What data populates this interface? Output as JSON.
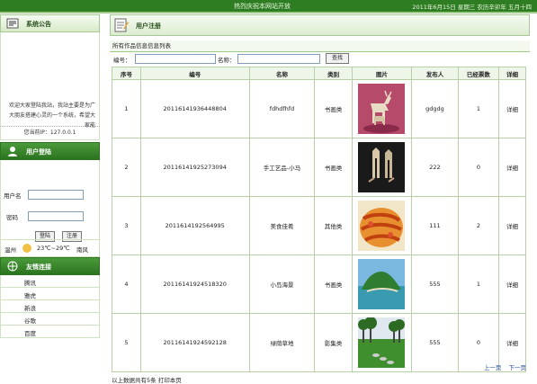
{
  "top_bar": {
    "welcome": "热烈庆祝本网站开放",
    "date": "2011年6月15日 星期三  农历辛卯年 五月十四"
  },
  "notice": {
    "title": "系统公告",
    "text": "欢迎大家登陆我站，我站主要是为广大朋友搭建心灵的一个系统，希望大家能"
  },
  "ip": "您当前IP：127.0.0.1",
  "login": {
    "title": "用户登陆",
    "username_label": "用户名",
    "password_label": "密码",
    "login_button": "登陆",
    "register_button": "注册"
  },
  "weather": {
    "city": "温州",
    "temp": "23℃~29℃",
    "wind": "南风"
  },
  "links": {
    "title": "友情连接",
    "items": [
      "腾讯",
      "雅虎",
      "新浪",
      "谷歌",
      "百度"
    ]
  },
  "main": {
    "page_title": "用户注册",
    "list_title": "所有作品信息信息列表",
    "search_code_label": "编号：",
    "search_name_label": "名称：",
    "search_button": "查找",
    "columns": [
      "序号",
      "编号",
      "名称",
      "类别",
      "图片",
      "发布人",
      "已经票数",
      "详细"
    ],
    "rows": [
      {
        "no": "1",
        "code": "20116141936448804",
        "name": "fdhdfhfd",
        "category": "书画类",
        "publisher": "gdgdg",
        "votes": "1",
        "detail": "详细"
      },
      {
        "no": "2",
        "code": "20116141925273094",
        "name": "手工艺品-小马",
        "category": "书画类",
        "publisher": "222",
        "votes": "0",
        "detail": "详细"
      },
      {
        "no": "3",
        "code": "2011614192564995",
        "name": "美食佳肴",
        "category": "其他类",
        "publisher": "111",
        "votes": "2",
        "detail": "详细"
      },
      {
        "no": "4",
        "code": "20116141924518320",
        "name": "小岛海景",
        "category": "书画类",
        "publisher": "555",
        "votes": "1",
        "detail": "详细"
      },
      {
        "no": "5",
        "code": "20116141924592128",
        "name": "绿荫草地",
        "category": "影集类",
        "publisher": "555",
        "votes": "0",
        "detail": "详细"
      }
    ],
    "prev_page": "上一页",
    "next_page": "下一页",
    "footer_text": "以上数据共有5条  打印本页"
  }
}
